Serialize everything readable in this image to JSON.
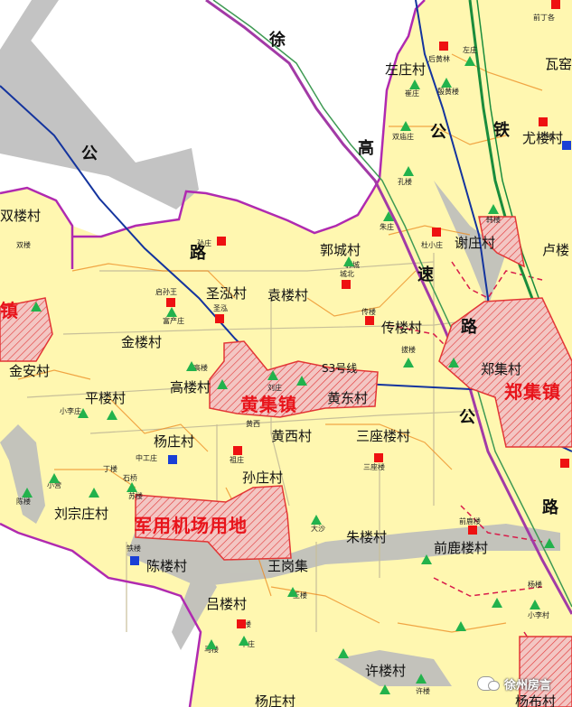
{
  "roads": {
    "xugaosu": [
      "徐",
      "高",
      "速",
      "公",
      "路"
    ],
    "xu_road": [
      "公",
      "路"
    ],
    "rail": "铁",
    "s3": "S3号线"
  },
  "towns": {
    "huangji": "黄集镇",
    "zhengji": "郑集镇",
    "airport": "军用机场用地"
  },
  "villages": [
    "双楼村",
    "左庄村",
    "瓦窑",
    "尤楼村",
    "谢庄村",
    "卢楼",
    "郭城村",
    "圣泓村",
    "袁楼村",
    "镇",
    "金楼村",
    "传楼村",
    "金安村",
    "高楼村",
    "郑集村",
    "黄东村",
    "平楼村",
    "杨庄村",
    "黄西村",
    "三座楼村",
    "孙庄村",
    "刘宗庄村",
    "陈楼村",
    "王岗集",
    "朱楼村",
    "前鹿楼村",
    "吕楼村",
    "许楼村",
    "杨庄村",
    "杨布村"
  ],
  "small_labels": [
    "前丁各",
    "后黄林",
    "左庄",
    "崔庄",
    "殷黄楼",
    "尤楼",
    "双庙庄",
    "孔楼",
    "双楼",
    "朱庄",
    "杜小庄",
    "韩楼",
    "孙庄",
    "郭城",
    "城北",
    "启孙王",
    "圣泓",
    "富产庄",
    "传楼",
    "拔楼",
    "高楼",
    "刘庄",
    "黄西",
    "大沙",
    "三座楼",
    "小李庄",
    "祖庄",
    "中工庄",
    "丁楼",
    "石桥",
    "苏楼",
    "小营",
    "陈楼",
    "铁楼",
    "前鹿楼",
    "王楼",
    "马楼",
    "中庄",
    "吕楼",
    "许楼",
    "杨楼",
    "小李村"
  ],
  "watermark": "徐州房言",
  "colors": {
    "land": "#fff7b0",
    "boundary_purple": "#b02ab0",
    "inner_boundary": "#ee7700",
    "water_blue": "#14349e",
    "rail_green": "#1a8c3c",
    "town_red": "#e8141b",
    "gray_road": "#b8b8b8"
  },
  "icons": {
    "village_seat": "red-square",
    "school": "green-triangle",
    "factory": "blue-square"
  }
}
